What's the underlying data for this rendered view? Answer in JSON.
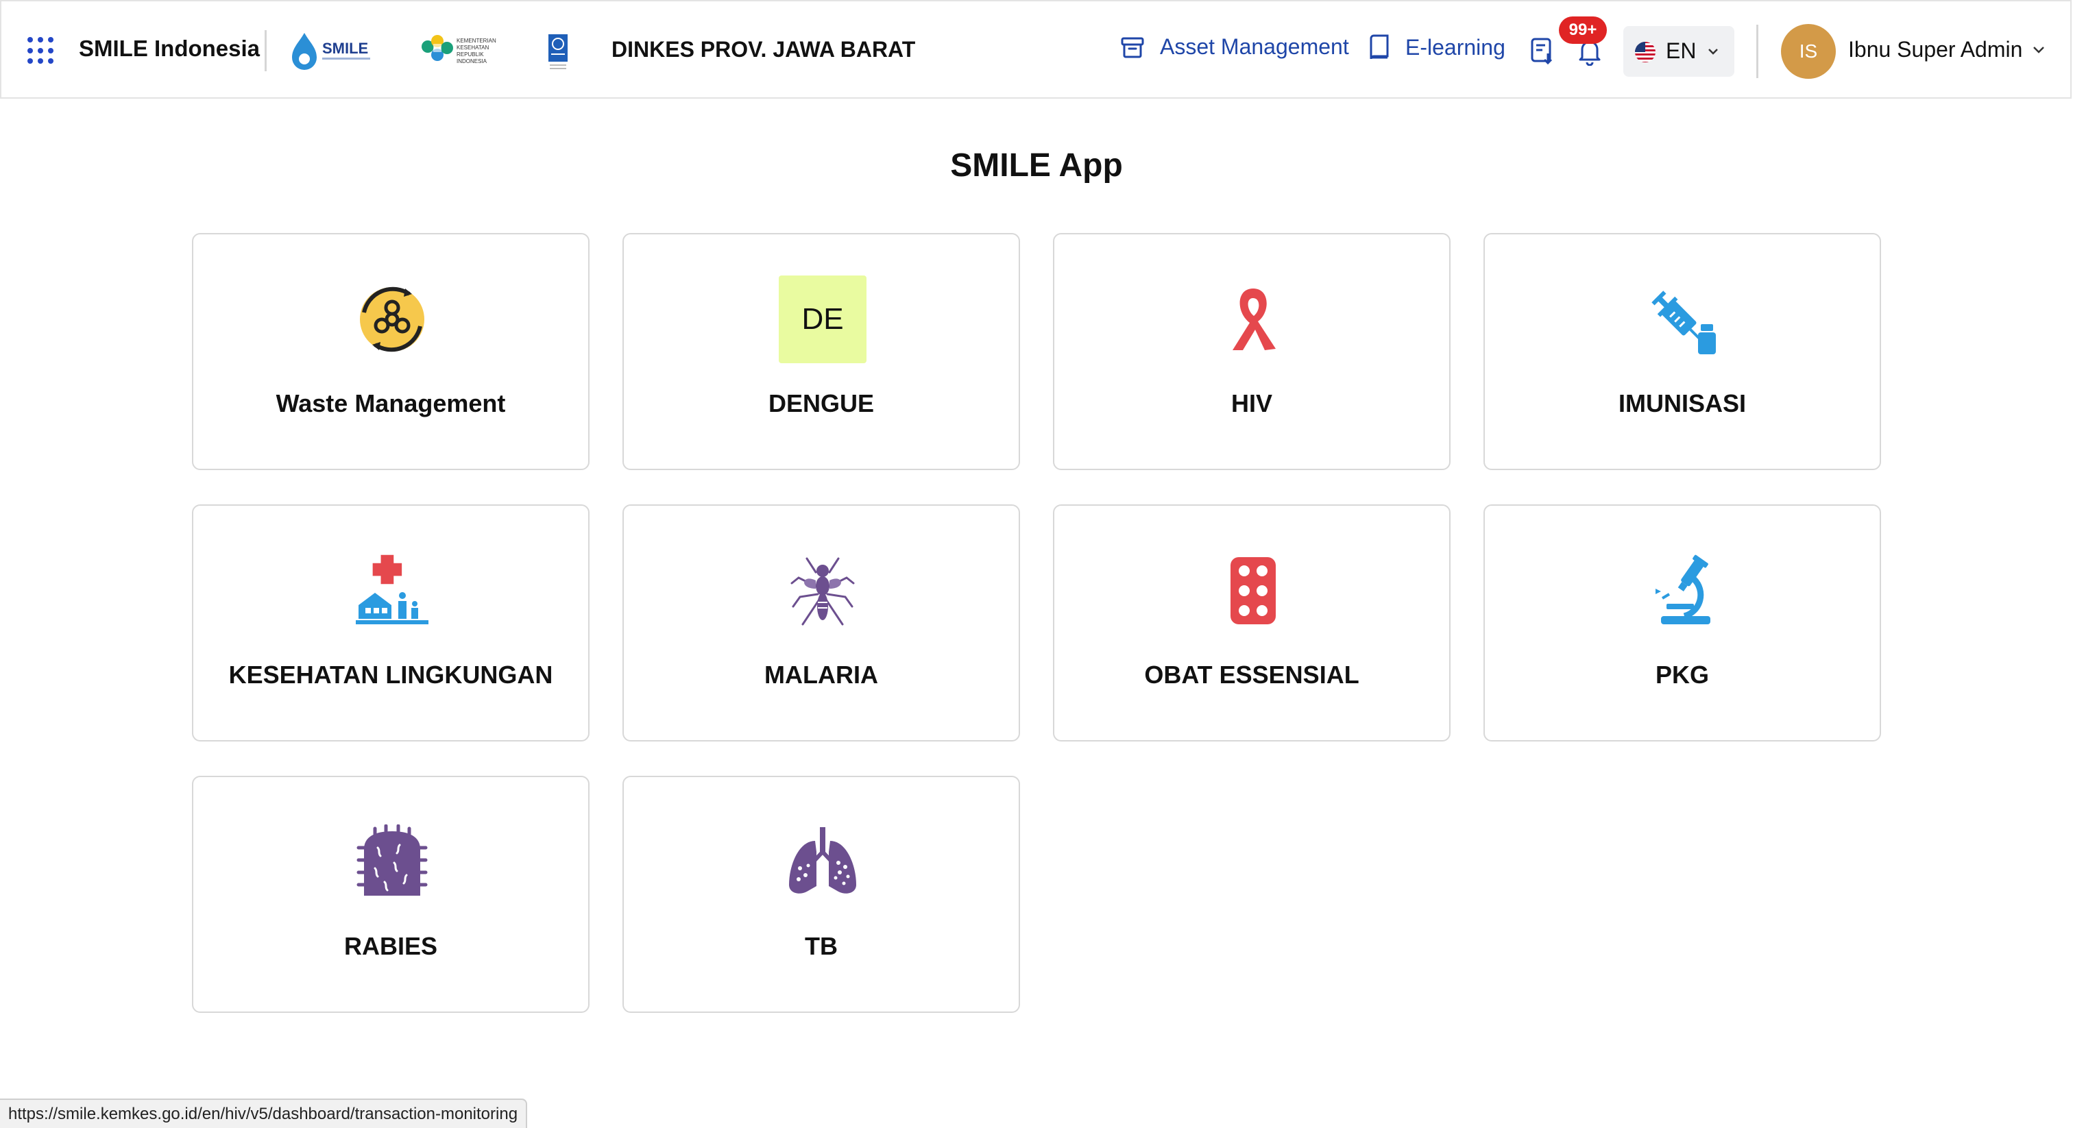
{
  "header": {
    "brand": "SMILE Indonesia",
    "org_name": "DINKES PROV. JAWA BARAT",
    "asset_management": "Asset Management",
    "elearning": "E-learning",
    "notifications_badge": "99+",
    "language": "EN",
    "avatar_initials": "IS",
    "user_name": "Ibnu Super Admin",
    "logo_smile_text": "SMILE",
    "logo_kemenkes_text": "KEMENTERIAN KESEHATAN REPUBLIK INDONESIA"
  },
  "main": {
    "title": "SMILE App",
    "apps": [
      {
        "name": "Waste Management",
        "icon": "biohazard-recycle-icon"
      },
      {
        "name": "DENGUE",
        "icon": "de-icon",
        "short": "DE"
      },
      {
        "name": "HIV",
        "icon": "awareness-ribbon-icon"
      },
      {
        "name": "IMUNISASI",
        "icon": "syringe-vial-icon"
      },
      {
        "name": "KESEHATAN LINGKUNGAN",
        "icon": "house-family-cross-icon"
      },
      {
        "name": "MALARIA",
        "icon": "mosquito-icon"
      },
      {
        "name": "OBAT ESSENSIAL",
        "icon": "pill-blister-icon"
      },
      {
        "name": "PKG",
        "icon": "microscope-icon"
      },
      {
        "name": "RABIES",
        "icon": "virus-icon"
      },
      {
        "name": "TB",
        "icon": "lungs-icon"
      }
    ]
  },
  "status_bar": {
    "url": "https://smile.kemkes.go.id/en/hiv/v5/dashboard/transaction-monitoring"
  },
  "colors": {
    "accent_blue": "#1f46a8",
    "badge_red": "#e02424",
    "avatar": "#d39a48",
    "purple": "#6c4f8f",
    "red": "#e5484d",
    "sky": "#2b9be0",
    "dengue_bg": "#e9fba0"
  }
}
